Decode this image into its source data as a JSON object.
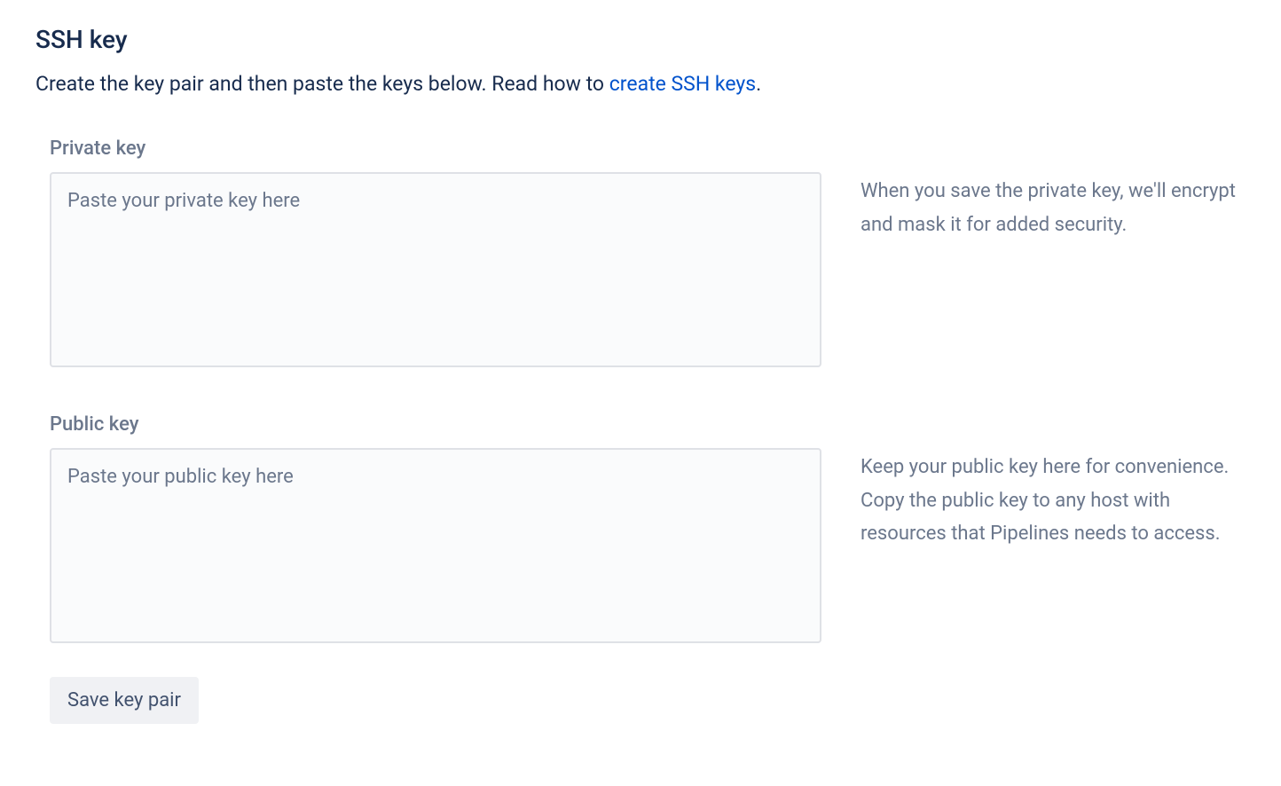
{
  "heading": "SSH key",
  "intro": {
    "prefix": "Create the key pair and then paste the keys below. Read how to ",
    "link_text": "create SSH keys",
    "suffix": "."
  },
  "private_key": {
    "label": "Private key",
    "placeholder": "Paste your private key here",
    "help": "When you save the private key, we'll encrypt and mask it for added security."
  },
  "public_key": {
    "label": "Public key",
    "placeholder": "Paste your public key here",
    "help": "Keep your public key here for convenience. Copy the public key to any host with resources that Pipelines needs to access."
  },
  "save_button_label": "Save key pair"
}
